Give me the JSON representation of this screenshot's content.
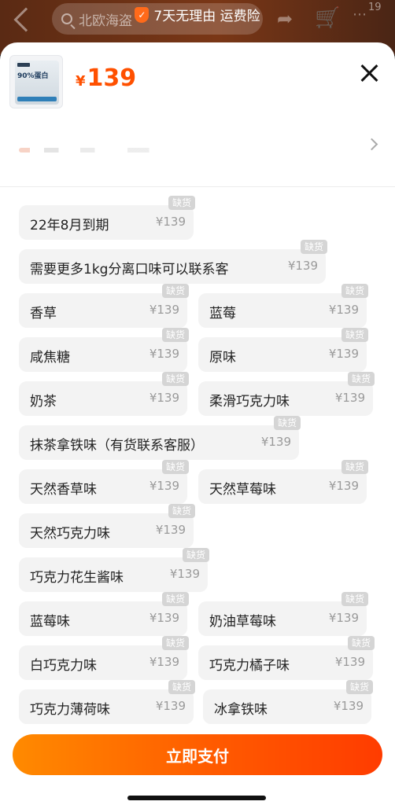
{
  "background": {
    "search_text": "北欧海盗",
    "guarantee_text": "7天无理由 运费险",
    "badge_count": "19"
  },
  "header": {
    "thumbnail_text": "90%蛋白",
    "currency": "¥",
    "price": "139"
  },
  "options": [
    {
      "name": "22年8月到期",
      "price": "¥139",
      "tag": "缺货"
    },
    {
      "name": "需要更多1kg分离口味可以联系客",
      "price": "¥139",
      "tag": "缺货"
    },
    {
      "name": "香草",
      "price": "¥139",
      "tag": "缺货"
    },
    {
      "name": "蓝莓",
      "price": "¥139",
      "tag": "缺货"
    },
    {
      "name": "咸焦糖",
      "price": "¥139",
      "tag": "缺货"
    },
    {
      "name": "原味",
      "price": "¥139",
      "tag": "缺货"
    },
    {
      "name": "奶茶",
      "price": "¥139",
      "tag": "缺货"
    },
    {
      "name": "柔滑巧克力味",
      "price": "¥139",
      "tag": "缺货"
    },
    {
      "name": "抹茶拿铁味（有货联系客服）",
      "price": "¥139",
      "tag": "缺货"
    },
    {
      "name": "天然香草味",
      "price": "¥139",
      "tag": "缺货"
    },
    {
      "name": "天然草莓味",
      "price": "¥139",
      "tag": "缺货"
    },
    {
      "name": "天然巧克力味",
      "price": "¥139",
      "tag": "缺货"
    },
    {
      "name": "巧克力花生酱味",
      "price": "¥139",
      "tag": "缺货"
    },
    {
      "name": "蓝莓味",
      "price": "¥139",
      "tag": "缺货"
    },
    {
      "name": "奶油草莓味",
      "price": "¥139",
      "tag": "缺货"
    },
    {
      "name": "白巧克力味",
      "price": "¥139",
      "tag": "缺货"
    },
    {
      "name": "巧克力橘子味",
      "price": "¥139",
      "tag": "缺货"
    },
    {
      "name": "巧克力薄荷味",
      "price": "¥139",
      "tag": "缺货"
    },
    {
      "name": "冰拿铁味",
      "price": "¥139",
      "tag": "缺货"
    }
  ],
  "footer": {
    "pay_label": "立即支付"
  },
  "colors": {
    "accent": "#ff5000",
    "pay_gradient_start": "#ff8a00",
    "pay_gradient_end": "#ff3c00",
    "chip_bg": "#f3f3f3",
    "sold_out_tag": "#d5d5d5"
  }
}
